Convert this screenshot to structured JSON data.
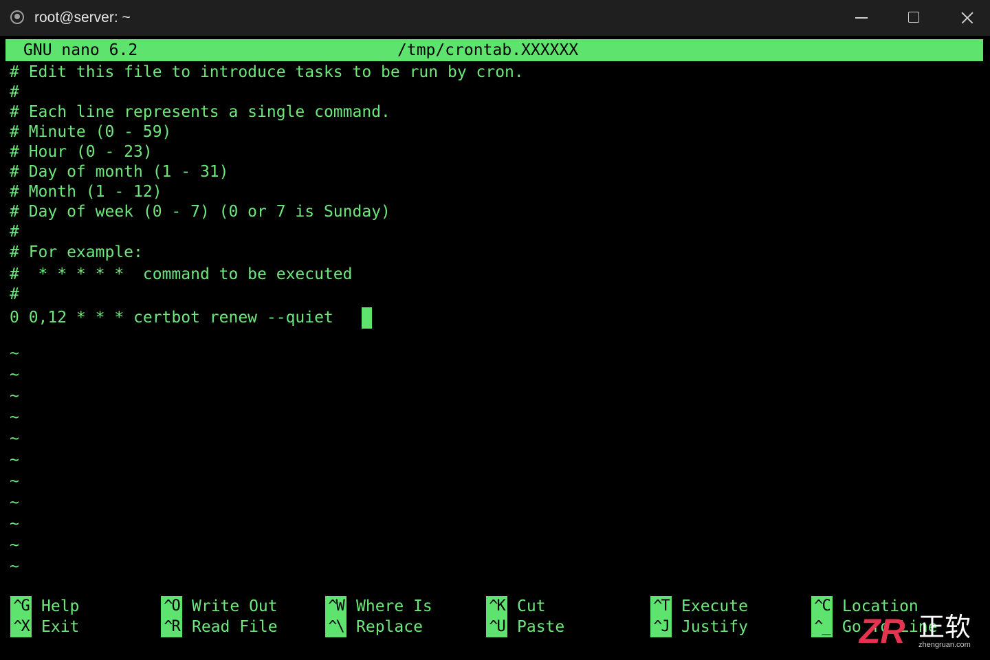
{
  "window": {
    "title": "root@server: ~",
    "icon": "terminal-icon"
  },
  "nano": {
    "version": "GNU nano 6.2",
    "filename": "/tmp/crontab.XXXXXX"
  },
  "editor": {
    "lines": [
      "# Edit this file to introduce tasks to be run by cron.",
      "#",
      "# Each line represents a single command.",
      "# Minute (0 - 59)",
      "# Hour (0 - 23)",
      "# Day of month (1 - 31)",
      "# Month (1 - 12)",
      "# Day of week (0 - 7) (0 or 7 is Sunday)",
      "#",
      "# For example:",
      "#  * * * * *  command to be executed",
      "#",
      "0 0,12 * * * certbot renew --quiet"
    ],
    "tilde": "~"
  },
  "shortcuts": [
    {
      "key": "^G",
      "label": "Help"
    },
    {
      "key": "^X",
      "label": "Exit"
    },
    {
      "key": "^O",
      "label": "Write Out"
    },
    {
      "key": "^R",
      "label": "Read File"
    },
    {
      "key": "^W",
      "label": "Where Is"
    },
    {
      "key": "^\\",
      "label": "Replace"
    },
    {
      "key": "^K",
      "label": "Cut"
    },
    {
      "key": "^U",
      "label": "Paste"
    },
    {
      "key": "^T",
      "label": "Execute"
    },
    {
      "key": "^J",
      "label": "Justify"
    },
    {
      "key": "^C",
      "label": "Location"
    },
    {
      "key": "^_",
      "label": "Go To Line"
    }
  ],
  "watermark": {
    "logo": "ZR",
    "name": "正软",
    "url": "zhengruan.com"
  },
  "colors": {
    "accent": "#5fe36f",
    "text": "#6ee87c",
    "background": "#000000",
    "titlebar": "#1f1f1f"
  }
}
